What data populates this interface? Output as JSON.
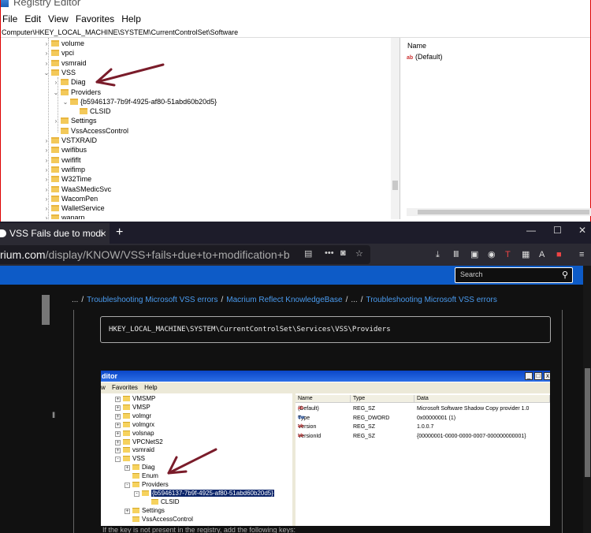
{
  "registry": {
    "title": "Registry Editor",
    "menu": [
      "File",
      "Edit",
      "View",
      "Favorites",
      "Help"
    ],
    "address": "Computer\\HKEY_LOCAL_MACHINE\\SYSTEM\\CurrentControlSet\\Software",
    "tree": [
      {
        "label": "volume",
        "indent": 0,
        "exp": ">"
      },
      {
        "label": "vpci",
        "indent": 0,
        "exp": ">"
      },
      {
        "label": "vsmraid",
        "indent": 0,
        "exp": ">"
      },
      {
        "label": "VSS",
        "indent": 0,
        "exp": "v"
      },
      {
        "label": "Diag",
        "indent": 1,
        "exp": ">"
      },
      {
        "label": "Providers",
        "indent": 1,
        "exp": "v"
      },
      {
        "label": "{b5946137-7b9f-4925-af80-51abd60b20d5}",
        "indent": 2,
        "exp": "v"
      },
      {
        "label": "CLSID",
        "indent": 3,
        "exp": ""
      },
      {
        "label": "Settings",
        "indent": 1,
        "exp": ">"
      },
      {
        "label": "VssAccessControl",
        "indent": 1,
        "exp": ""
      },
      {
        "label": "VSTXRAID",
        "indent": 0,
        "exp": ">"
      },
      {
        "label": "vwifibus",
        "indent": 0,
        "exp": ">"
      },
      {
        "label": "vwififlt",
        "indent": 0,
        "exp": ">"
      },
      {
        "label": "vwifimp",
        "indent": 0,
        "exp": ">"
      },
      {
        "label": "W32Time",
        "indent": 0,
        "exp": ">"
      },
      {
        "label": "WaaSMedicSvc",
        "indent": 0,
        "exp": ">"
      },
      {
        "label": "WacomPen",
        "indent": 0,
        "exp": ">"
      },
      {
        "label": "WalletService",
        "indent": 0,
        "exp": ">"
      },
      {
        "label": "wanarp",
        "indent": 0,
        "exp": ">"
      }
    ],
    "values_header": "Name",
    "values": [
      {
        "icon": "ab",
        "name": "(Default)"
      }
    ]
  },
  "browser": {
    "tab_title": "VSS Fails due to modi",
    "tab_close": "×",
    "new_tab": "+",
    "url_host": "rium.com",
    "url_path": "/display/KNOW/VSS+fails+due+to+modification+b",
    "search_placeholder": "Search",
    "breadcrumbs": {
      "ellipsis_start": "...",
      "item1": "Troubleshooting Microsoft VSS errors",
      "item2": "Macrium Reflect KnowledgeBase",
      "ellipsis_mid": "...",
      "item3": "Troubleshooting Microsoft VSS errors",
      "sep": "/"
    },
    "code_path": "HKEY_LOCAL_MACHINE\\SYSTEM\\CurrentControlSet\\Services\\VSS\\Providers",
    "bottom_text": "If the key is not present in the registry, add the following keys:"
  },
  "embedded": {
    "title": "ditor",
    "menu": [
      "w",
      "Favorites",
      "Help"
    ],
    "tree": [
      {
        "label": "VMSMP",
        "indent": 0,
        "box": "+"
      },
      {
        "label": "VMSP",
        "indent": 0,
        "box": "+"
      },
      {
        "label": "volmgr",
        "indent": 0,
        "box": "+"
      },
      {
        "label": "volmgrx",
        "indent": 0,
        "box": "+"
      },
      {
        "label": "volsnap",
        "indent": 0,
        "box": "+"
      },
      {
        "label": "VPCNetS2",
        "indent": 0,
        "box": "+"
      },
      {
        "label": "vsmraid",
        "indent": 0,
        "box": "+"
      },
      {
        "label": "VSS",
        "indent": 0,
        "box": "-"
      },
      {
        "label": "Diag",
        "indent": 1,
        "box": "+"
      },
      {
        "label": "Enum",
        "indent": 1,
        "box": ""
      },
      {
        "label": "Providers",
        "indent": 1,
        "box": "-"
      },
      {
        "label": "{b5946137-7b9f-4925-af80-51abd60b20d5}",
        "indent": 2,
        "box": "-",
        "selected": true
      },
      {
        "label": "CLSID",
        "indent": 3,
        "box": ""
      },
      {
        "label": "Settings",
        "indent": 1,
        "box": "+"
      },
      {
        "label": "VssAccessControl",
        "indent": 1,
        "box": ""
      }
    ],
    "headers": {
      "name": "Name",
      "type": "Type",
      "data": "Data"
    },
    "rows": [
      {
        "icon": "ab",
        "name": "(Default)",
        "type": "REG_SZ",
        "data": "Microsoft Software Shadow Copy provider 1.0"
      },
      {
        "icon": "dw",
        "name": "Type",
        "type": "REG_DWORD",
        "data": "0x00000001 (1)"
      },
      {
        "icon": "ab",
        "name": "Version",
        "type": "REG_SZ",
        "data": "1.0.0.7"
      },
      {
        "icon": "ab",
        "name": "VersionId",
        "type": "REG_SZ",
        "data": "{00000001-0000-0000-0007-000000000001}"
      }
    ]
  },
  "colors": {
    "accent_blue": "#0d5bc7",
    "link_blue": "#4a9bef",
    "arrow_maroon": "#7a1c2a",
    "selection": "#0a246a"
  },
  "icons": [
    "regedit-app-icon",
    "folder-icon",
    "reg-sz-icon",
    "arrow-annotation",
    "search-icon",
    "reader-view-icon",
    "pocket-icon",
    "bookmark-star-icon",
    "downloads-icon",
    "library-icon",
    "sidebar-icon",
    "menu-icon"
  ]
}
